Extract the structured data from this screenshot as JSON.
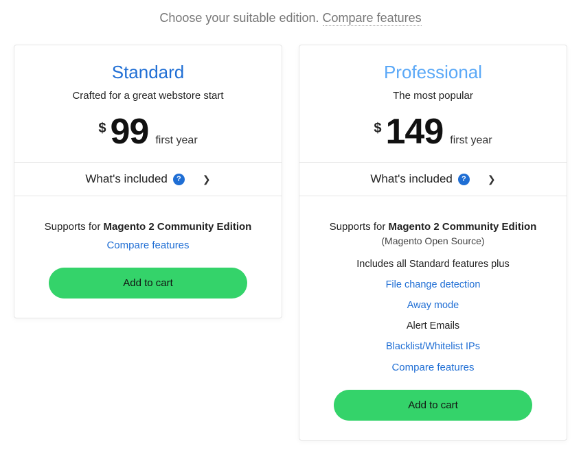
{
  "header": {
    "lead": "Choose your suitable edition. ",
    "compare_label": "Compare features"
  },
  "plans": {
    "standard": {
      "title": "Standard",
      "tagline": "Crafted for a great webstore start",
      "currency": "$",
      "amount": "99",
      "period": "first year",
      "included_label": "What's included",
      "supports_prefix": "Supports for ",
      "supports_bold": "Magento 2 Community Edition",
      "compare_label": "Compare features",
      "cta": "Add to cart"
    },
    "professional": {
      "title": "Professional",
      "tagline": "The most popular",
      "currency": "$",
      "amount": "149",
      "period": "first year",
      "included_label": "What's included",
      "supports_prefix": "Supports for ",
      "supports_bold": "Magento 2 Community Edition",
      "supports_sub": "(Magento Open Source)",
      "feature_intro": "Includes all Standard features plus",
      "features": [
        {
          "label": "File change detection",
          "link": true
        },
        {
          "label": "Away mode",
          "link": true
        },
        {
          "label": "Alert Emails",
          "link": false
        },
        {
          "label": "Blacklist/Whitelist IPs",
          "link": true
        }
      ],
      "compare_label": "Compare features",
      "cta": "Add to cart"
    }
  }
}
